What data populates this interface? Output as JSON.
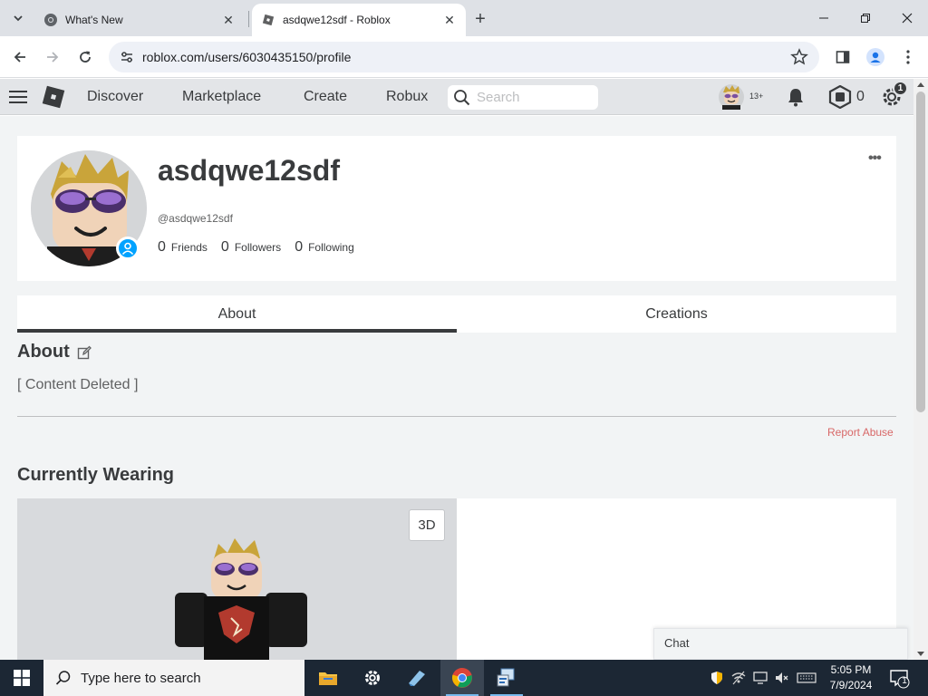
{
  "browser": {
    "tabs": [
      {
        "title": "What's New",
        "active": false
      },
      {
        "title": "asdqwe12sdf - Roblox",
        "active": true
      }
    ],
    "url": "roblox.com/users/6030435150/profile"
  },
  "nav": {
    "links": [
      "Discover",
      "Marketplace",
      "Create",
      "Robux"
    ],
    "search_placeholder": "Search",
    "age_label": "13+",
    "robux_count": "0",
    "settings_badge": "1"
  },
  "profile": {
    "display_name": "asdqwe12sdf",
    "username": "@asdqwe12sdf",
    "stats": [
      {
        "count": "0",
        "label": "Friends"
      },
      {
        "count": "0",
        "label": "Followers"
      },
      {
        "count": "0",
        "label": "Following"
      }
    ],
    "more_label": "•••"
  },
  "tabs": {
    "about": "About",
    "creations": "Creations"
  },
  "about": {
    "heading": "About",
    "body": "[ Content Deleted ]",
    "report_label": "Report Abuse"
  },
  "wearing": {
    "heading": "Currently Wearing",
    "view_toggle": "3D"
  },
  "chat": {
    "label": "Chat"
  },
  "taskbar": {
    "search_placeholder": "Type here to search",
    "time": "5:05 PM",
    "date": "7/9/2024",
    "notification_count": "1"
  },
  "colors": {
    "nav_bg": "#e3e5e8",
    "page_bg": "#f2f4f5",
    "text_primary": "#393b3d",
    "report_red": "#d86868",
    "online_blue": "#00a2ff"
  }
}
